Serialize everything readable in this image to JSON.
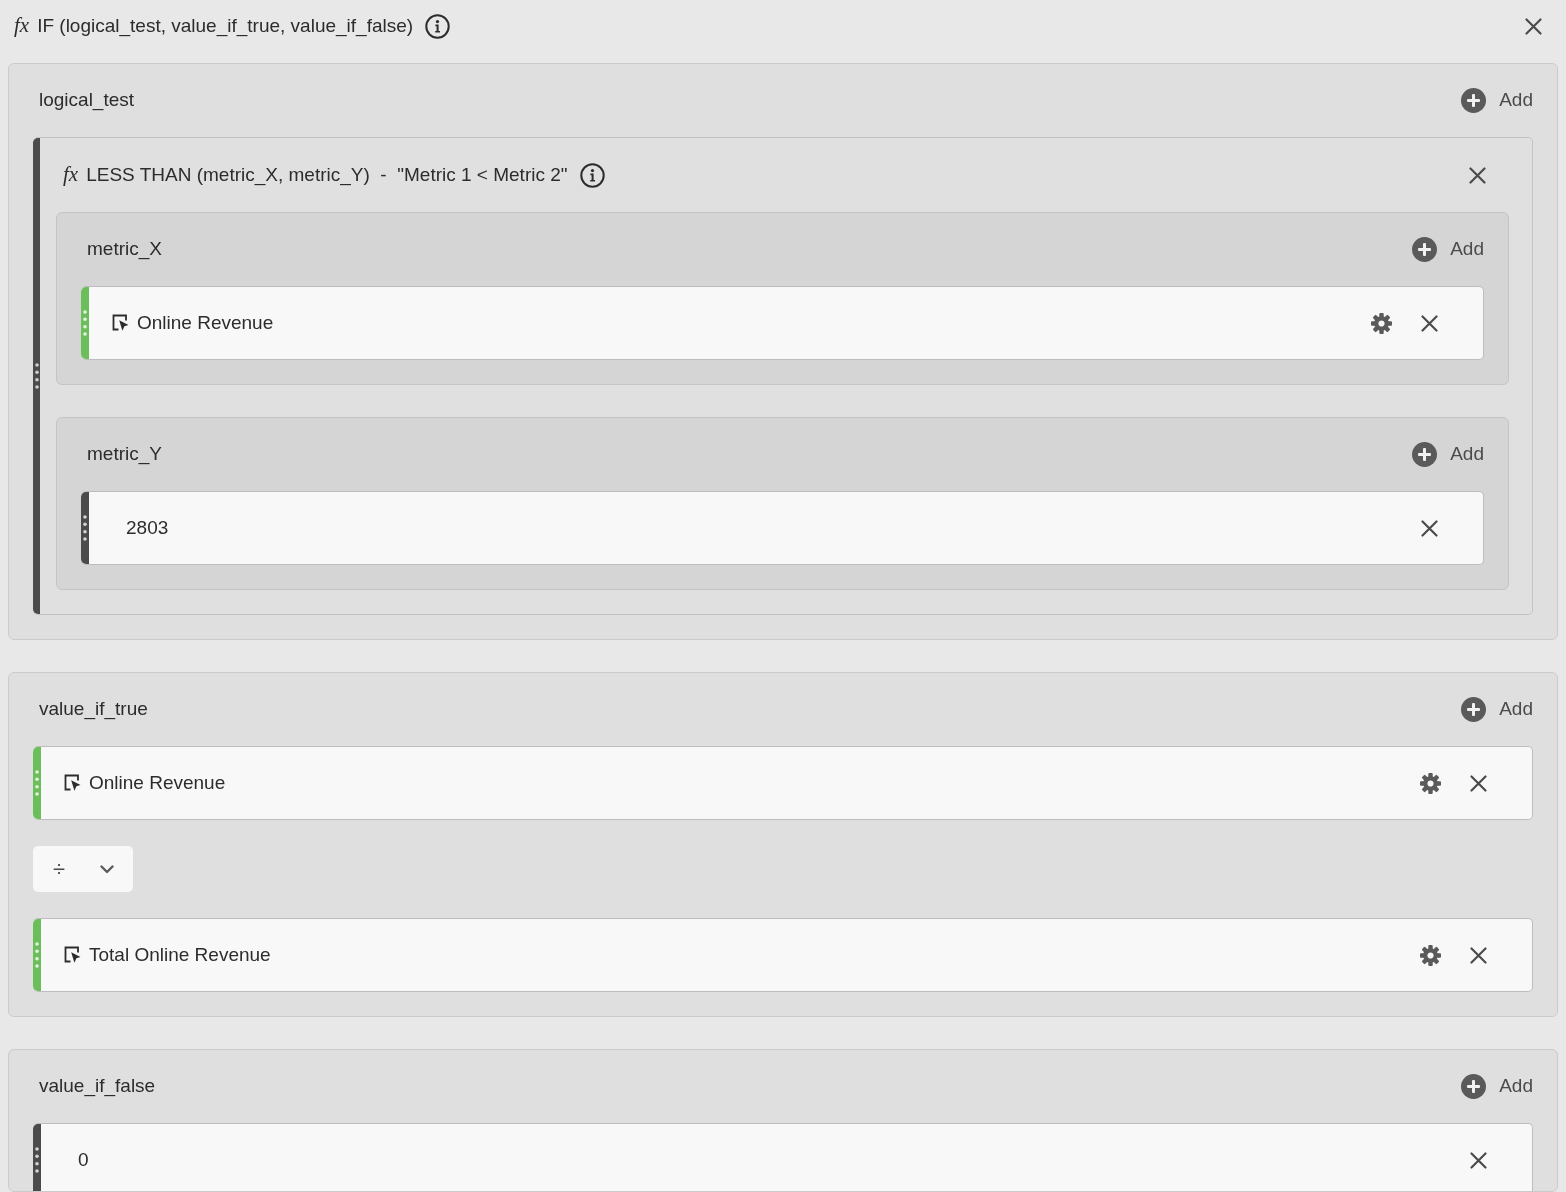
{
  "header": {
    "symbol": "fx",
    "title": "IF (logical_test, value_if_true, value_if_false)"
  },
  "arguments": [
    {
      "label": "logical_test",
      "add_label": "Add",
      "items": [
        {
          "kind": "function",
          "symbol": "fx",
          "title": "LESS THAN (metric_X, metric_Y)  -  \"Metric 1 < Metric 2\"",
          "arguments": [
            {
              "label": "metric_X",
              "add_label": "Add",
              "items": [
                {
                  "kind": "metric",
                  "label": "Online Revenue"
                }
              ]
            },
            {
              "label": "metric_Y",
              "add_label": "Add",
              "items": [
                {
                  "kind": "number",
                  "value": "2803"
                }
              ]
            }
          ]
        }
      ]
    },
    {
      "label": "value_if_true",
      "add_label": "Add",
      "items": [
        {
          "kind": "metric",
          "label": "Online Revenue"
        },
        {
          "kind": "operator",
          "symbol": "÷"
        },
        {
          "kind": "metric",
          "label": "Total Online Revenue"
        }
      ]
    },
    {
      "label": "value_if_false",
      "add_label": "Add",
      "items": [
        {
          "kind": "number",
          "value": "0"
        }
      ]
    }
  ]
}
